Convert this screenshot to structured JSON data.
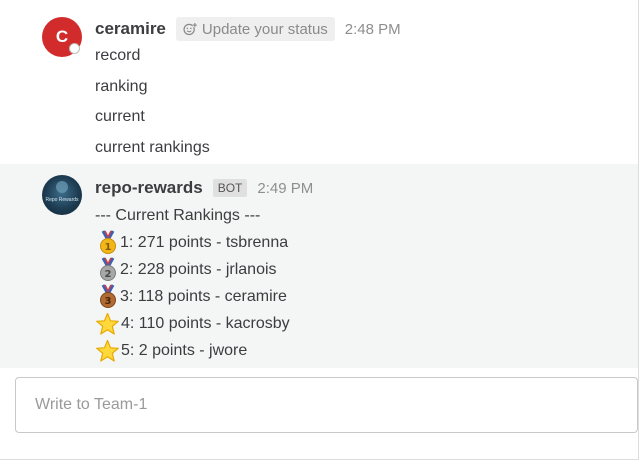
{
  "posts": [
    {
      "avatar_letter": "C",
      "username": "ceramire",
      "status_button_label": "Update your status",
      "time": "2:48 PM",
      "lines": [
        "record",
        "ranking",
        "current",
        "current rankings"
      ]
    },
    {
      "avatar_label": "Repo Rewards",
      "username": "repo-rewards",
      "badge": "BOT",
      "time": "2:49 PM",
      "heading": "--- Current Rankings ---",
      "rankings": [
        {
          "icon": "gold-medal-icon",
          "text": "1: 271 points - tsbrenna"
        },
        {
          "icon": "silver-medal-icon",
          "text": "2: 228 points - jrlanois"
        },
        {
          "icon": "bronze-medal-icon",
          "text": "3: 118 points - ceramire"
        },
        {
          "icon": "star-icon",
          "text": "4: 110 points - kacrosby"
        },
        {
          "icon": "star-icon",
          "text": "5: 2 points - jwore"
        }
      ]
    }
  ],
  "composer": {
    "placeholder": "Write to Team-1"
  },
  "colors": {
    "avatar_red": "#d22b2b",
    "post_hover_bg": "#f4f6f5",
    "gold": "#f2b61b",
    "silver": "#a7a7a7",
    "bronze": "#b06a33",
    "star": "#ffd93b"
  }
}
